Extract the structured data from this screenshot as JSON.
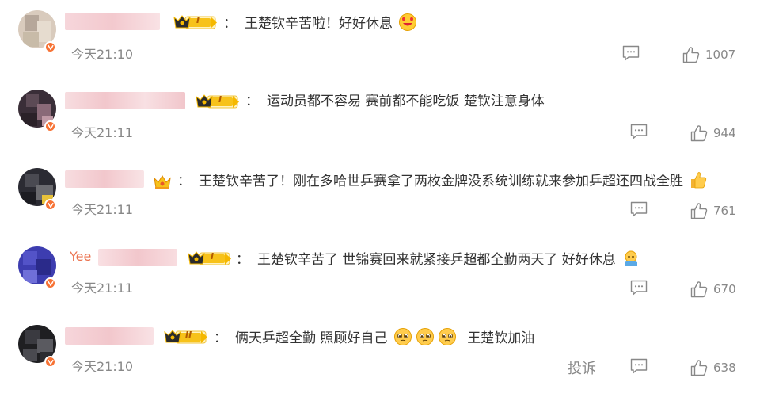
{
  "comments": [
    {
      "name_visible": "",
      "text": "王楚钦辛苦啦！好好休息",
      "time": "今天21:10",
      "likes": "1007",
      "badge": "I",
      "emojis": [
        "smile-heart-emoji"
      ]
    },
    {
      "name_visible": "",
      "text": "运动员都不容易 赛前都不能吃饭 楚钦注意身体",
      "time": "今天21:11",
      "likes": "944",
      "badge": "I",
      "emojis": []
    },
    {
      "name_visible": "",
      "text": "王楚钦辛苦了！刚在多哈世乒赛拿了两枚金牌没系统训练就来参加乒超还四战全胜",
      "time": "今天21:11",
      "likes": "761",
      "badge": "",
      "emojis": [
        "thumbs-up-emoji"
      ]
    },
    {
      "name_visible": "Yee",
      "text": "王楚钦辛苦了 世锦赛回来就紧接乒超都全勤两天了 好好休息",
      "time": "今天21:11",
      "likes": "670",
      "badge": "I",
      "emojis": [
        "sleepy-emoji"
      ]
    },
    {
      "name_visible": "",
      "text_before": "俩天乒超全勤 照顾好自己",
      "text_after": "王楚钦加油",
      "time": "今天21:10",
      "likes": "638",
      "badge": "II",
      "report": "投诉",
      "emojis": [
        "pleading-emoji",
        "pleading-emoji",
        "pleading-emoji"
      ]
    }
  ],
  "colon": "：",
  "colors": {
    "accent": "#f77234",
    "gray": "#888888",
    "text": "#333333",
    "crown_gold": "#f5b800"
  }
}
